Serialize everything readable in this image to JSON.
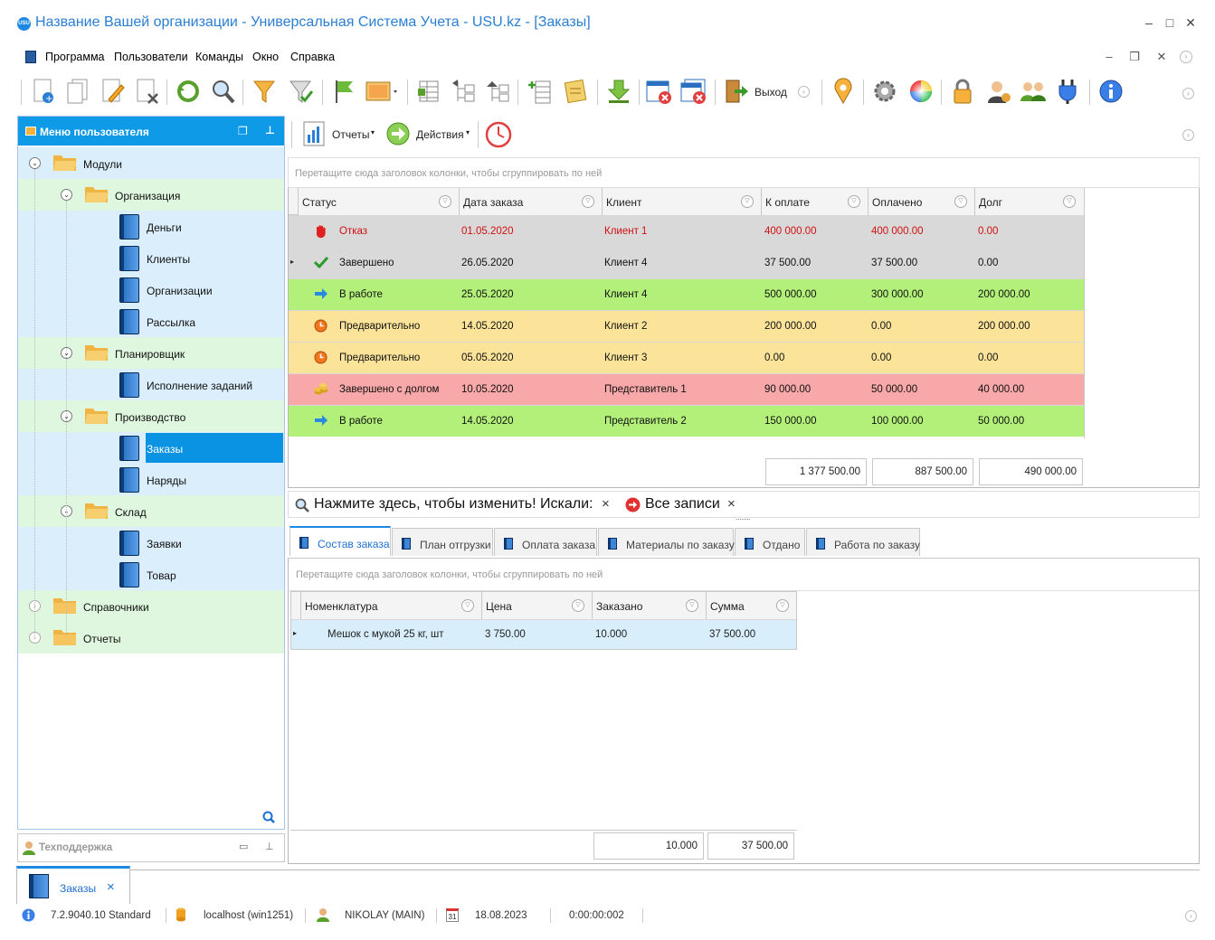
{
  "window": {
    "title": "Название Вашей организации - Универсальная Система Учета - USU.kz - [Заказы]",
    "logo_text": "USU"
  },
  "menu": {
    "items": [
      "Программа",
      "Пользователи",
      "Команды",
      "Окно",
      "Справка"
    ]
  },
  "toolbar": {
    "exit_label": "Выход"
  },
  "sidebar": {
    "title": "Меню пользователя",
    "tree": {
      "modules": "Модули",
      "org": "Организация",
      "money": "Деньги",
      "clients": "Клиенты",
      "orgs": "Организации",
      "mailing": "Рассылка",
      "planner": "Планировщик",
      "tasks": "Исполнение заданий",
      "production": "Производство",
      "orders": "Заказы",
      "work_orders": "Наряды",
      "warehouse": "Склад",
      "requests": "Заявки",
      "goods": "Товар",
      "refs": "Справочники",
      "reports": "Отчеты"
    },
    "support": "Техподдержка"
  },
  "subtoolbar": {
    "reports": "Отчеты",
    "actions": "Действия"
  },
  "orders": {
    "group_hint": "Перетащите сюда заголовок колонки, чтобы сгруппировать по ней",
    "columns": [
      "Статус",
      "Дата заказа",
      "Клиент",
      "К оплате",
      "Оплачено",
      "Долг"
    ],
    "rows": [
      {
        "status": "Отказ",
        "date": "01.05.2020",
        "client": "Клиент 1",
        "to_pay": "400 000.00",
        "paid": "400 000.00",
        "debt": "0.00",
        "bg": "#d9d9d9",
        "color": "#d01010",
        "icon": "stop-hand-icon"
      },
      {
        "status": "Завершено",
        "date": "26.05.2020",
        "client": "Клиент 4",
        "to_pay": "37 500.00",
        "paid": "37 500.00",
        "debt": "0.00",
        "bg": "#d9d9d9",
        "color": "#111111",
        "icon": "checkmark-icon"
      },
      {
        "status": "В работе",
        "date": "25.05.2020",
        "client": "Клиент 4",
        "to_pay": "500 000.00",
        "paid": "300 000.00",
        "debt": "200 000.00",
        "bg": "#b3f07a",
        "color": "#111111",
        "icon": "arrow-right-icon"
      },
      {
        "status": "Предварительно",
        "date": "14.05.2020",
        "client": "Клиент 2",
        "to_pay": "200 000.00",
        "paid": "0.00",
        "debt": "200 000.00",
        "bg": "#fbe49a",
        "color": "#111111",
        "icon": "clock-icon"
      },
      {
        "status": "Предварительно",
        "date": "05.05.2020",
        "client": "Клиент 3",
        "to_pay": "0.00",
        "paid": "0.00",
        "debt": "0.00",
        "bg": "#fbe49a",
        "color": "#111111",
        "icon": "clock-icon"
      },
      {
        "status": "Завершено с долгом",
        "date": "10.05.2020",
        "client": "Представитель 1",
        "to_pay": "90 000.00",
        "paid": "50 000.00",
        "debt": "40 000.00",
        "bg": "#f8a8a8",
        "color": "#111111",
        "icon": "coins-icon"
      },
      {
        "status": "В работе",
        "date": "14.05.2020",
        "client": "Представитель 2",
        "to_pay": "150 000.00",
        "paid": "100 000.00",
        "debt": "50 000.00",
        "bg": "#b3f07a",
        "color": "#111111",
        "icon": "arrow-right-icon"
      }
    ],
    "totals": {
      "to_pay": "1 377 500.00",
      "paid": "887 500.00",
      "debt": "490 000.00"
    }
  },
  "search_bar": {
    "text": "Нажмите здесь, чтобы изменить! Искали:",
    "close": "×",
    "all_records": "Все записи",
    "close2": "×"
  },
  "tabs": [
    "Состав заказа",
    "План отгрузки",
    "Оплата заказа",
    "Материалы по заказу",
    "Отдано",
    "Работа по заказу"
  ],
  "details": {
    "group_hint": "Перетащите сюда заголовок колонки, чтобы сгруппировать по ней",
    "columns": [
      "Номенклатура",
      "Цена",
      "Заказано",
      "Сумма"
    ],
    "rows": [
      {
        "item": "Мешок с мукой 25 кг, шт",
        "price": "3 750.00",
        "qty": "10.000",
        "sum": "37 500.00"
      }
    ],
    "totals": {
      "qty": "10.000",
      "sum": "37 500.00"
    }
  },
  "window_tab": {
    "label": "Заказы",
    "close": "×"
  },
  "status": {
    "version": "7.2.9040.10 Standard",
    "server": "localhost (win1251)",
    "user": "NIKOLAY (MAIN)",
    "date": "18.08.2023",
    "calendar_day": "31",
    "timer": "0:00:00:002"
  }
}
